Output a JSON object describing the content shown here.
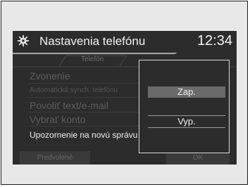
{
  "header": {
    "title": "Nastavenia telefónu",
    "time": "12:34"
  },
  "tab": {
    "label": "Telefón"
  },
  "menu": {
    "items": [
      "Zvonenie",
      "Automatická synch. telefónu",
      "Povoliť text/e-mail",
      "Vybrať konto",
      "Upozornenie na novú správu"
    ]
  },
  "footer": {
    "left_button": "Predvolené",
    "right_button": "OK"
  },
  "popup": {
    "option_on": "Zap.",
    "option_off": "Vyp."
  },
  "icons": {
    "header": "gear-icon"
  }
}
